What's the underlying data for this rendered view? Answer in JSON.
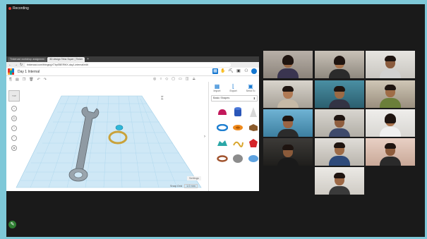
{
  "recording": {
    "label": "Recording"
  },
  "browser": {
    "tabs": [
      "Tinkercad workshop assignmen",
      "3D design Teba Squer | Tinker",
      "+"
    ],
    "url": "tinkercad.com/things/gXTbpEBERWX-day1-internal/edit",
    "design_title": "Day 1 Internal"
  },
  "tinkercad": {
    "panel_tabs": [
      {
        "label": "Import",
        "icon": "grid-icon"
      },
      {
        "label": "Export",
        "icon": "l-shape-icon"
      },
      {
        "label": "Send To",
        "icon": "send-icon"
      }
    ],
    "shape_category": "Basic Shapes",
    "cube_label": "TOP",
    "settings_label": "Settings",
    "snap_label": "Snap Grid",
    "snap_value": "1.0 mm"
  },
  "participants": {
    "count": 13,
    "colors": {
      "speaker_border": "#3aa63a"
    }
  },
  "colors": {
    "frame": "#7ec8d8",
    "tinkercad_blue": "#1477d1",
    "grid": "#cfe8f6"
  }
}
